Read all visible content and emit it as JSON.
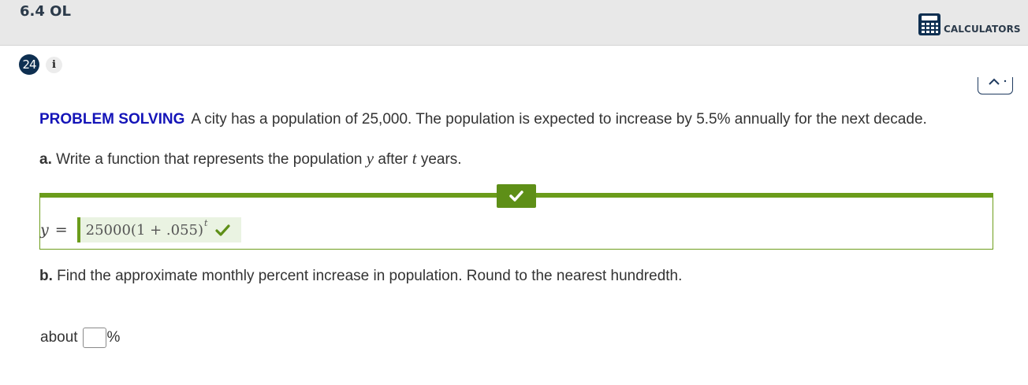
{
  "header": {
    "lesson_title": "6.4 OL",
    "calculators_label": "CALCULATORS",
    "calculator_icon": "calculator-icon"
  },
  "question": {
    "number": "24",
    "info_label": "i"
  },
  "problem": {
    "label": "PROBLEM SOLVING",
    "text": "A city has a population of 25,000. The population is expected to increase by 5.5% annually for the next decade."
  },
  "part_a": {
    "letter": "a.",
    "text_before_y": "Write a function that represents the population",
    "var_y": "y",
    "text_after": "after",
    "var_t": "t",
    "text_end": "years.",
    "answer_lhs": "y",
    "equals": "=",
    "answer_base": "25000(1 + .055)",
    "answer_exponent": "t",
    "status": "correct"
  },
  "part_b": {
    "letter": "b.",
    "text": "Find the approximate monthly percent increase in population. Round to the nearest hundredth.",
    "about_label": "about",
    "answer_value": "",
    "percent_sign": "%"
  },
  "colors": {
    "correct_green": "#6b9c1b",
    "problem_label_blue": "#1414b8",
    "question_badge": "#0e2f51"
  }
}
